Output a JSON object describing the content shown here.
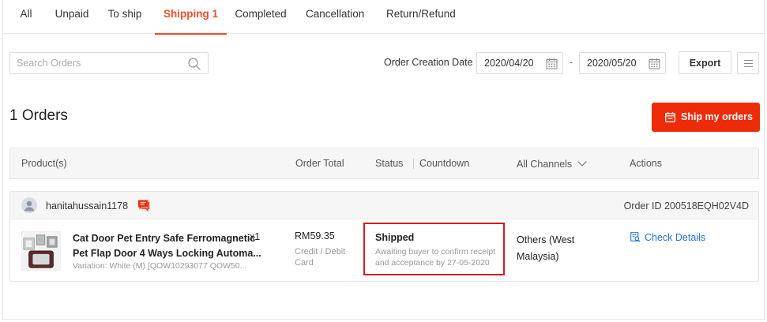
{
  "tabs": [
    {
      "label": "All"
    },
    {
      "label": "Unpaid"
    },
    {
      "label": "To ship"
    },
    {
      "label": "Shipping 1",
      "active": true
    },
    {
      "label": "Completed"
    },
    {
      "label": "Cancellation"
    },
    {
      "label": "Return/Refund"
    }
  ],
  "toolbar": {
    "search_placeholder": "Search Orders",
    "date_label": "Order Creation Date",
    "date_from": "2020/04/20",
    "date_separator": "-",
    "date_to": "2020/05/20",
    "export_label": "Export"
  },
  "orders": {
    "count_label": "1 Orders",
    "ship_button_label": "Ship my orders"
  },
  "table_header": {
    "product": "Product(s)",
    "order_total": "Order Total",
    "status": "Status",
    "countdown": "Countdown",
    "channels": "All Channels",
    "actions": "Actions"
  },
  "order": {
    "username": "hanitahussain1178",
    "order_id": "Order ID 200518EQH02V4D",
    "product_name_line1": "Cat Door Pet Entry Safe Ferromagnetic",
    "product_name_line2": "Pet Flap Door 4 Ways Locking Automa...",
    "quantity": "x1",
    "variation": "Variation: White (M) [QOW10293077 QOW50...",
    "price": "RM59.35",
    "payment": "Credit / Debit Card",
    "status_title": "Shipped",
    "status_desc": "Awaiting buyer to confirm receipt and acceptance by 27-05-2020",
    "channel": "Others (West Malaysia)",
    "action_label": "Check Details"
  },
  "colors": {
    "accent": "#ee4d2d",
    "ship_button": "#ee2c09",
    "highlight_border": "#d11e25",
    "link": "#2673dd"
  }
}
